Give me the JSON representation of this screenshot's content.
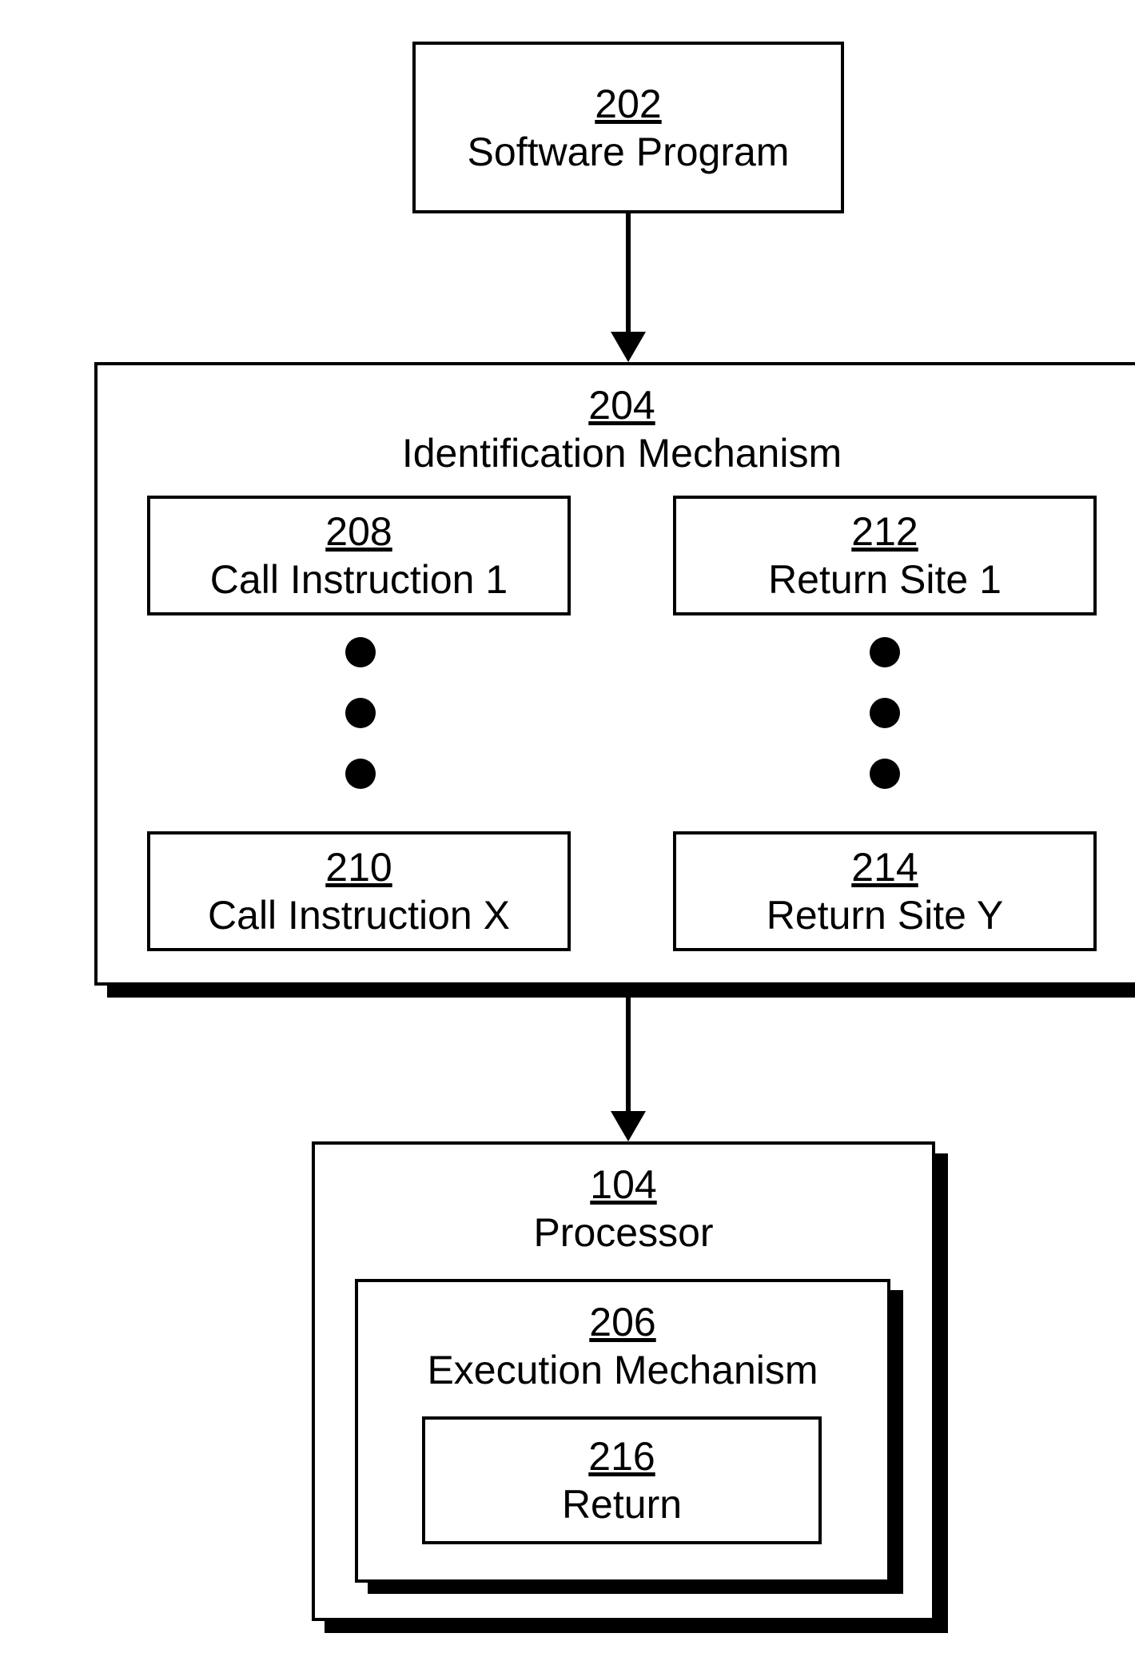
{
  "blocks": {
    "software_program": {
      "ref": "202",
      "label": "Software Program"
    },
    "identification_mechanism": {
      "ref": "204",
      "label": "Identification Mechanism"
    },
    "call_instruction_1": {
      "ref": "208",
      "label": "Call Instruction 1"
    },
    "call_instruction_x": {
      "ref": "210",
      "label": "Call Instruction X"
    },
    "return_site_1": {
      "ref": "212",
      "label": "Return Site 1"
    },
    "return_site_y": {
      "ref": "214",
      "label": "Return Site Y"
    },
    "processor": {
      "ref": "104",
      "label": "Processor"
    },
    "execution_mechanism": {
      "ref": "206",
      "label": "Execution Mechanism"
    },
    "return": {
      "ref": "216",
      "label": "Return"
    }
  }
}
